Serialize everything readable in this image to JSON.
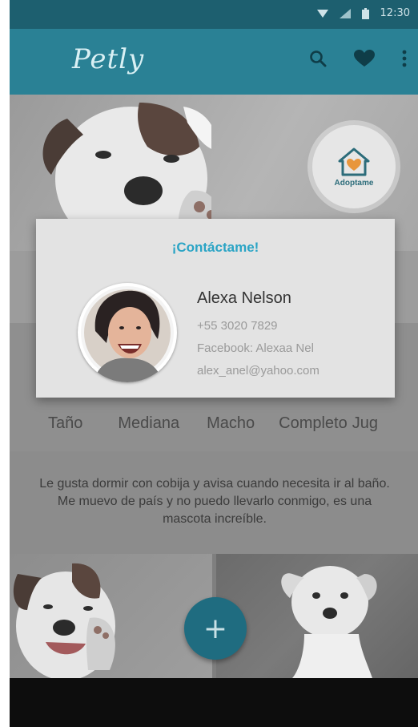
{
  "status_bar": {
    "time": "12:30"
  },
  "app_bar": {
    "title": "Petly",
    "icons": [
      "search-icon",
      "heart-icon",
      "more-vert-icon"
    ]
  },
  "hero": {
    "adopt_label": "Adoptame"
  },
  "traits": [
    "Taño",
    "Mediana",
    "Macho",
    "Completo",
    "Jug"
  ],
  "description": "Le gusta dormir con cobija y avisa cuando necesita ir al baño. Me muevo de país y no puedo llevarlo conmigo, es una mascota increíble.",
  "fab": {
    "label": "+"
  },
  "dialog": {
    "title": "¡Contáctame!",
    "name": "Alexa Nelson",
    "phone": "+55 3020 7829",
    "facebook": "Facebook: Alexaa Nel",
    "email": "alex_anel@yahoo.com"
  },
  "colors": {
    "status_bar": "#1d5f6f",
    "app_bar": "#2a8195",
    "accent": "#2aa4c5",
    "fab": "#1f6c80",
    "badge_heart": "#e8963c"
  }
}
